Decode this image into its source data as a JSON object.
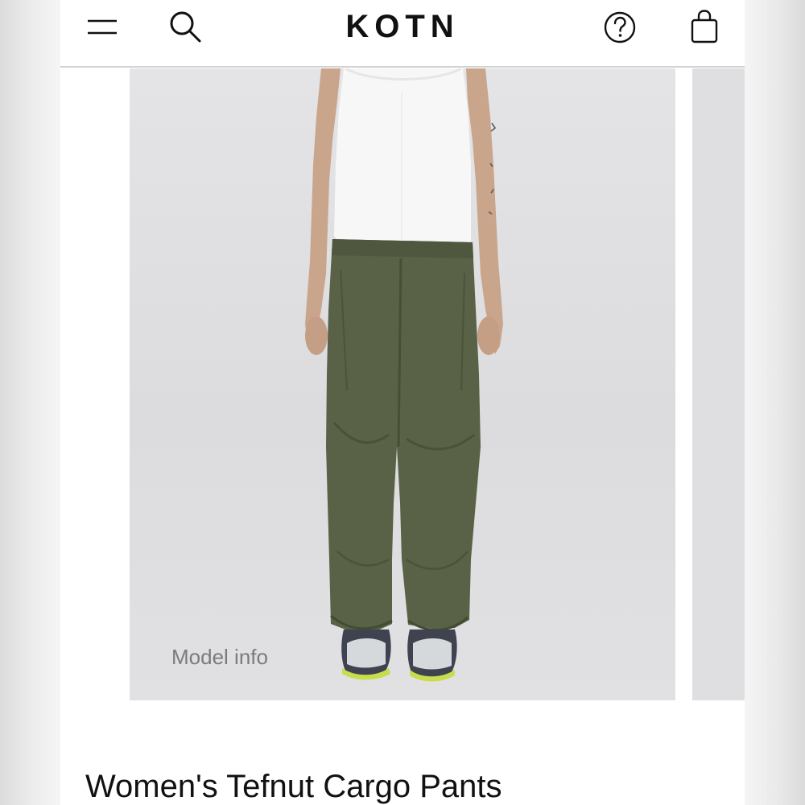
{
  "header": {
    "menu_icon": "hamburger-menu-icon",
    "search_icon": "search-icon",
    "logo_text": "KOTN",
    "help_icon": "question-circle-icon",
    "bag_icon": "shopping-bag-icon"
  },
  "gallery": {
    "model_info_label": "Model info"
  },
  "product": {
    "title": "Women's Tefnut Cargo Pants"
  },
  "colors": {
    "page_background": "#ffffff",
    "text": "#111111",
    "muted_text": "#7b7b7b",
    "pants": "#596146",
    "image_background": "#e1e1e3"
  }
}
